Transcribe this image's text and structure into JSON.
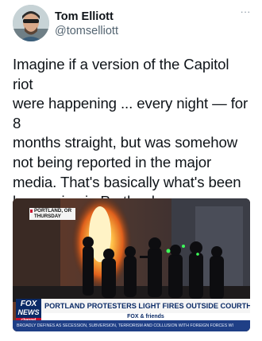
{
  "author": {
    "display_name": "Tom Elliott",
    "handle": "@tomselliott",
    "avatar_icon": "person-avatar-icon"
  },
  "menu_icon": "more-dots-icon",
  "menu_glyph": "···",
  "tweet": {
    "text": "Imagine if a version of the Capitol riot\nwere happening ... every night — for 8\nmonths straight, but was somehow\nnot being reported in the major\nmedia. That's basically what's been\nhappening in Portland."
  },
  "media": {
    "location_tag": "PORTLAND, OR THURSDAY",
    "network_logo_line1": "FOX",
    "network_logo_line2": "NEWS",
    "network_logo_line3": "channel",
    "headline": "PORTLAND PROTESTERS LIGHT FIRES OUTSIDE COURTHOUSE",
    "brand": "FOX & friends",
    "ticker": "BROADLY DEFINES AS SECESSION, SUBVERSION, TERRORISM AND COLLUSION WITH FOREIGN FORCES WI"
  }
}
